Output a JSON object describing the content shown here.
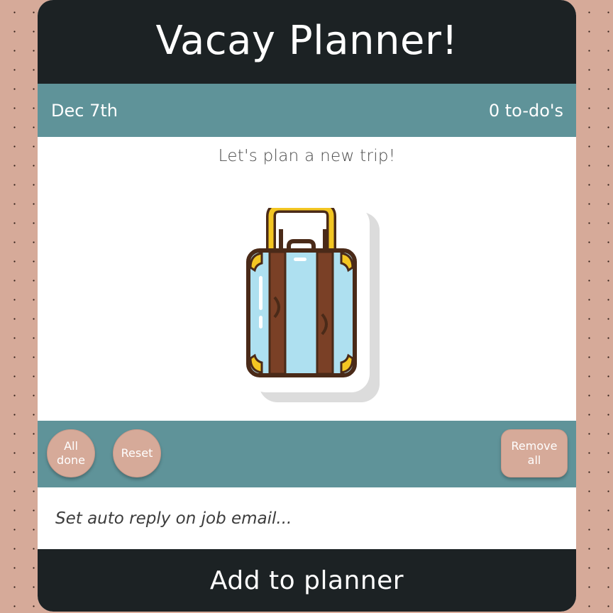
{
  "header": {
    "title": "Vacay Planner!"
  },
  "info_bar": {
    "date": "Dec 7th",
    "todo_count": "0 to-do's"
  },
  "content": {
    "prompt": "Let's plan a new trip!",
    "illustration_icon": "suitcase-icon"
  },
  "actions": {
    "all_done_line1": "All",
    "all_done_line2": "done",
    "reset": "Reset",
    "remove_all_line1": "Remove",
    "remove_all_line2": "all"
  },
  "input": {
    "placeholder": "Set auto reply on job email...",
    "value": ""
  },
  "add_button": {
    "label": "Add to planner"
  },
  "colors": {
    "background": "#d6aa99",
    "dark": "#1c2224",
    "teal": "#5f9399",
    "button": "#d6aa99"
  }
}
